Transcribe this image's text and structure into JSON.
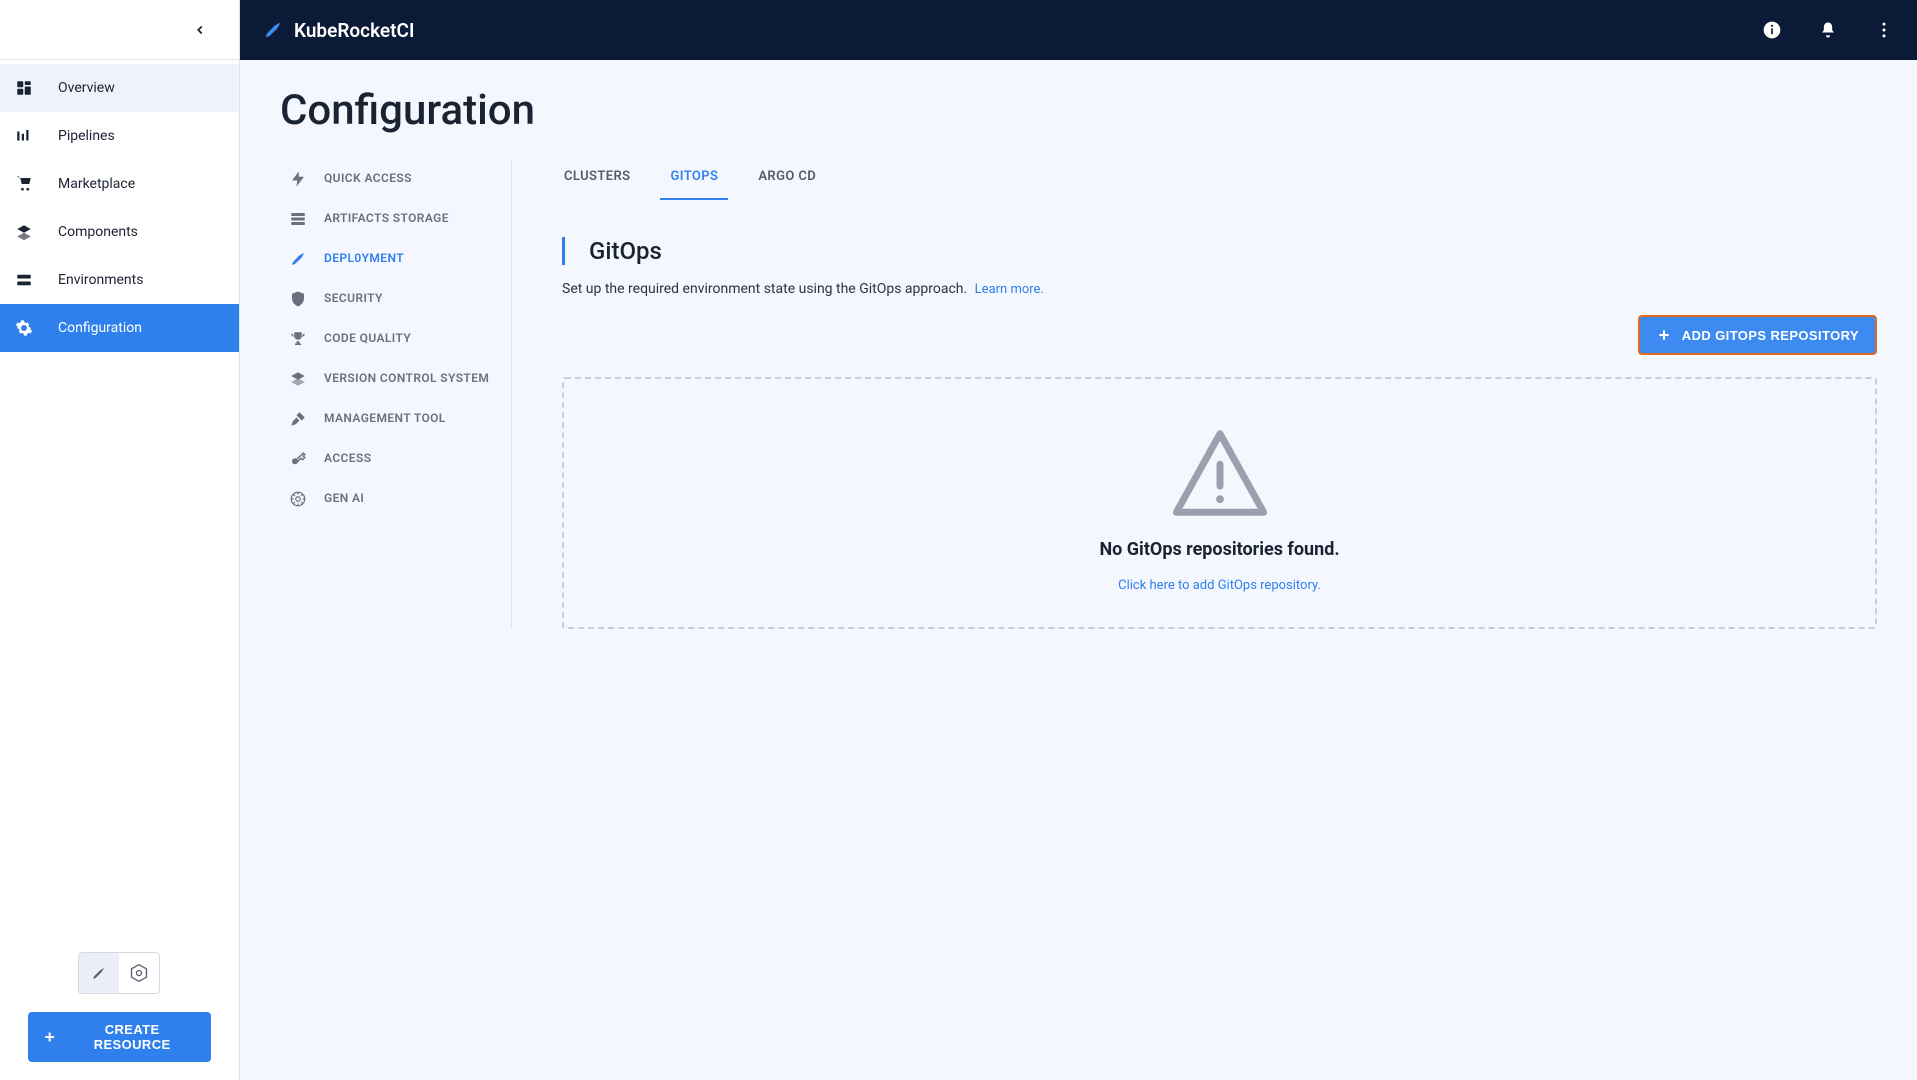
{
  "brand": {
    "name": "KubeRocketCI"
  },
  "sidebar": {
    "items": [
      {
        "label": "Overview"
      },
      {
        "label": "Pipelines"
      },
      {
        "label": "Marketplace"
      },
      {
        "label": "Components"
      },
      {
        "label": "Environments"
      },
      {
        "label": "Configuration"
      }
    ],
    "create_button": "CREATE RESOURCE"
  },
  "page": {
    "title": "Configuration"
  },
  "subnav": {
    "items": [
      {
        "label": "QUICK ACCESS"
      },
      {
        "label": "ARTIFACTS STORAGE"
      },
      {
        "label": "DEPL0YMENT"
      },
      {
        "label": "SECURITY"
      },
      {
        "label": "CODE QUALITY"
      },
      {
        "label": "VERSION CONTROL SYSTEM"
      },
      {
        "label": "MANAGEMENT TOOL"
      },
      {
        "label": "ACCESS"
      },
      {
        "label": "GEN AI"
      }
    ]
  },
  "tabs": {
    "items": [
      {
        "label": "CLUSTERS"
      },
      {
        "label": "GITOPS"
      },
      {
        "label": "ARGO CD"
      }
    ]
  },
  "section": {
    "title": "GitOps",
    "subtitle": "Set up the required environment state using the GitOps approach.",
    "learn_more": "Learn more.",
    "add_button": "ADD GITOPS REPOSITORY"
  },
  "empty": {
    "title": "No GitOps repositories found.",
    "link": "Click here to add GitOps repository."
  }
}
